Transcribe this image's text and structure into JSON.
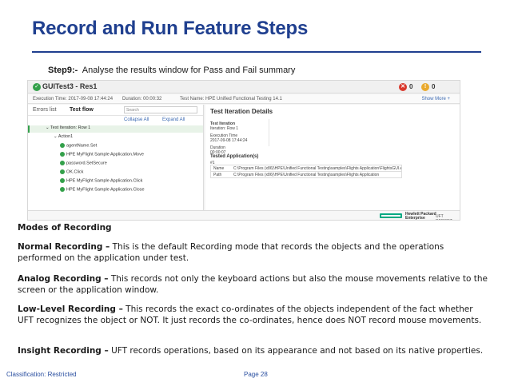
{
  "slide": {
    "title": "Record and Run Feature Steps",
    "step_label": "Step9:-",
    "step_text": "Analyse the results window for Pass and Fail summary"
  },
  "screenshot": {
    "window_title": "GUITest3 - Res1",
    "error_count": "0",
    "warning_count": "0",
    "meta": {
      "exec_time": "Execution Time: 2017-09-08 17:44:24",
      "duration": "Duration: 00:00:32",
      "test_name": "Test Name: HPE Unified Functional Testing 14.1",
      "show_more": "Show More +"
    },
    "left_pane": {
      "tab_errors": "Errors list",
      "tab_flow": "Test flow",
      "search_placeholder": "Search",
      "collapse_all": "Collapse All",
      "expand_all": "Expand All",
      "tree": [
        "Test Iteration: Row 1",
        "Action1",
        "agentName.Set",
        "HPE MyFlight Sample Application.Move",
        "password.SetSecure",
        "OK.Click",
        "HPE MyFlight Sample Application.Click",
        "HPE MyFlight Sample Application.Close"
      ]
    },
    "right_pane": {
      "title": "Test Iteration Details",
      "iteration_label": "Test Iteration",
      "iteration_value": "Iteration: Row 1",
      "exec_time_label": "Execution Time",
      "exec_time_value": "2017-09-08 17:44:24",
      "duration_label": "Duration",
      "duration_value": "00:00:07",
      "tested_apps": "Tested Application(s)",
      "apps_index": "#1",
      "row1_key": "Name",
      "row1_val": "C:\\Program Files (x86)\\HPE\\Unified Functional Testing\\samples\\Flights Application\\FlightsGUI.exe",
      "row2_key": "Path",
      "row2_val": "C:\\Program Files (x86)\\HPE\\Unified Functional Testing\\samples\\Flights Application"
    },
    "footer": {
      "hpe_line1": "Hewlett Packard",
      "hpe_line2": "Enterprise",
      "report": "UFT REPORT"
    }
  },
  "body": {
    "modes_heading": "Modes of Recording",
    "p1_bold": "Normal Recording –",
    "p1_text": " This is the default Recording mode that records the objects and the operations performed on the application under test.",
    "p2_bold": "Analog Recording –",
    "p2_text": " This records not only the keyboard actions but also the mouse movements relative to the screen or the application window.",
    "p3_bold": "Low-Level Recording –",
    "p3_text": " This records the exact co-ordinates of the objects independent of the fact whether UFT recognizes the object or NOT. It just records the co-ordinates, hence does NOT record mouse movements.",
    "p4_bold": "Insight Recording –",
    "p4_text": " UFT records operations, based on its appearance and not based on its native properties."
  },
  "footer": {
    "classification": "Classification: Restricted",
    "page": "Page 28"
  },
  "colors": {
    "title_blue": "#1f3f8f",
    "pass_green": "#33a04a",
    "error_red": "#d9382c",
    "warning_yellow": "#e9a92d",
    "hpe_green": "#01a982"
  }
}
